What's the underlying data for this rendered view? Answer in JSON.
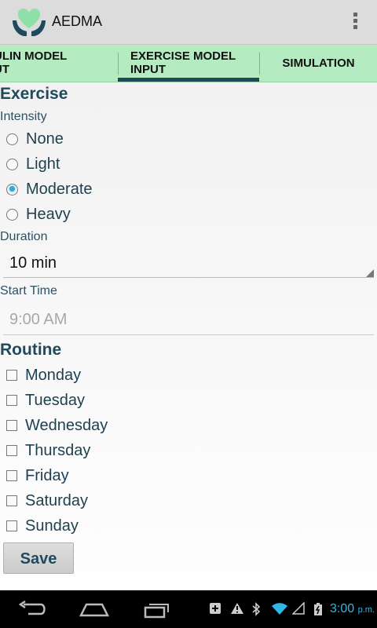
{
  "app": {
    "title": "AEDMA"
  },
  "tabs": [
    {
      "label_line1": "SULIN MODEL",
      "label_line2": "PUT"
    },
    {
      "label_line1": "EXERCISE MODEL",
      "label_line2": "INPUT"
    },
    {
      "label": "SIMULATION"
    }
  ],
  "exercise": {
    "title": "Exercise",
    "intensity": {
      "label": "Intensity",
      "options": [
        "None",
        "Light",
        "Moderate",
        "Heavy"
      ],
      "selected": "Moderate"
    },
    "duration": {
      "label": "Duration",
      "value": "10 min"
    },
    "start_time": {
      "label": "Start Time",
      "placeholder": "9:00 AM"
    }
  },
  "routine": {
    "title": "Routine",
    "days": [
      "Monday",
      "Tuesday",
      "Wednesday",
      "Thursday",
      "Friday",
      "Saturday",
      "Sunday"
    ]
  },
  "save_label": "Save",
  "status_bar": {
    "time": "3:00",
    "ampm": "p.m."
  },
  "colors": {
    "tab_bg": "#b4ebc0",
    "tab_indicator": "#1e4a5c",
    "heading": "#1f4a5e",
    "radio_on": "#33b5e5",
    "clock": "#33b5e5"
  }
}
